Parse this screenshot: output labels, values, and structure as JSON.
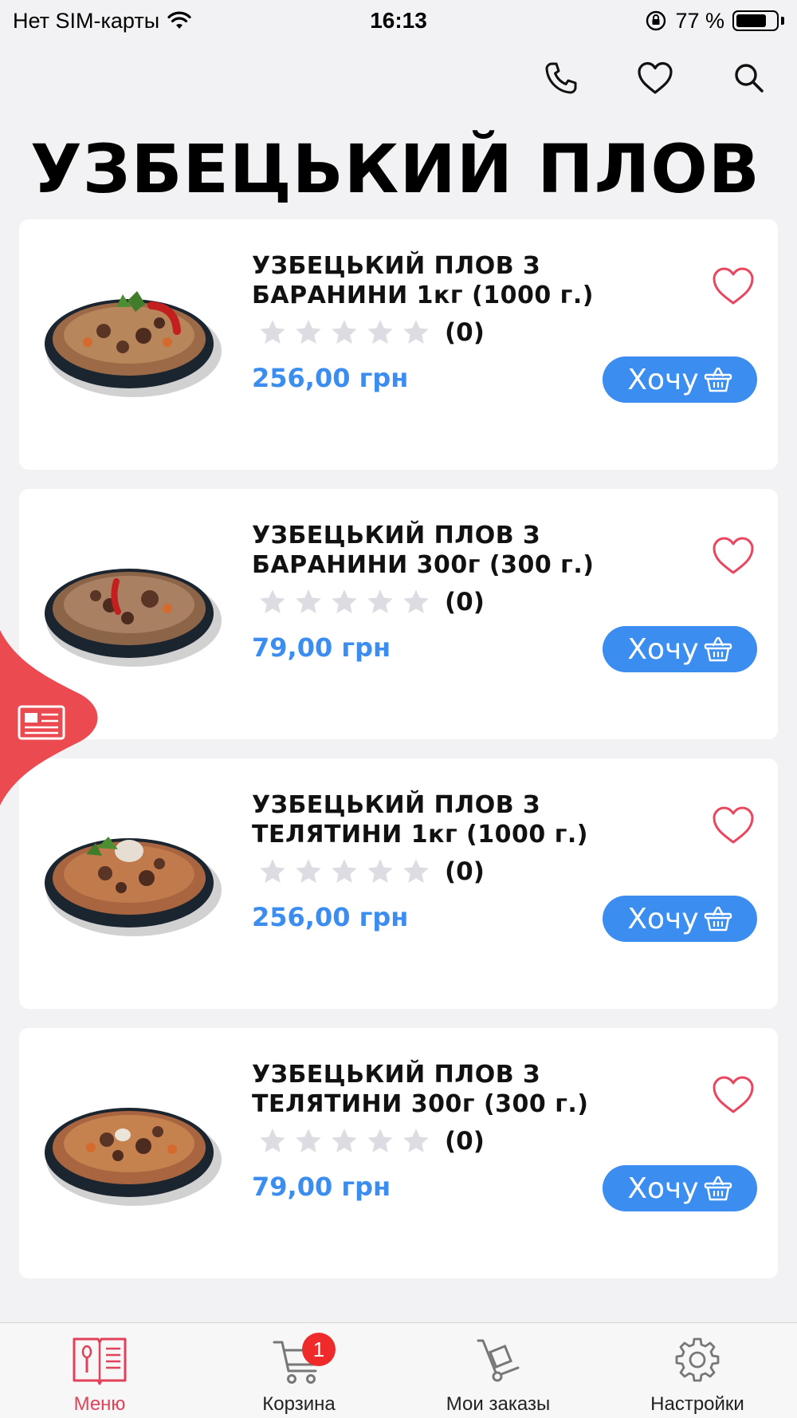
{
  "status_bar": {
    "carrier": "Нет SIM-карты",
    "time": "16:13",
    "battery": "77 %"
  },
  "page": {
    "title": "УЗБЕЦЬКИЙ ПЛОВ"
  },
  "products": [
    {
      "name": "УЗБЕЦЬКИЙ ПЛОВ З БАРАНИНИ 1кг (1000 г.)",
      "rating_count": "(0)",
      "rating": 0,
      "price": "256,00 грн",
      "buy_label": "Хочу"
    },
    {
      "name": "УЗБЕЦЬКИЙ ПЛОВ З БАРАНИНИ 300г (300 г.)",
      "rating_count": "(0)",
      "rating": 0,
      "price": "79,00 грн",
      "buy_label": "Хочу"
    },
    {
      "name": "УЗБЕЦЬКИЙ ПЛОВ З ТЕЛЯТИНИ 1кг (1000 г.)",
      "rating_count": "(0)",
      "rating": 0,
      "price": "256,00 грн",
      "buy_label": "Хочу"
    },
    {
      "name": "УЗБЕЦЬКИЙ ПЛОВ З ТЕЛЯТИНИ 300г (300 г.)",
      "rating_count": "(0)",
      "rating": 0,
      "price": "79,00 грн",
      "buy_label": "Хочу"
    }
  ],
  "tabbar": {
    "menu": "Меню",
    "cart": "Корзина",
    "cart_badge": "1",
    "orders": "Мои заказы",
    "settings": "Настройки"
  },
  "colors": {
    "accent_blue": "#3b8ef0",
    "accent_red": "#e0425a",
    "side_tab": "#eb4b50",
    "badge": "#ee2a2a"
  },
  "icons": {
    "toolbar": [
      "phone-icon",
      "heart-icon",
      "search-icon"
    ],
    "card": [
      "heart-outline-icon",
      "star-icon",
      "basket-icon"
    ],
    "side_tab": "newspaper-icon",
    "tabs": [
      "menu-book-icon",
      "cart-icon",
      "hand-truck-icon",
      "gear-icon"
    ]
  }
}
